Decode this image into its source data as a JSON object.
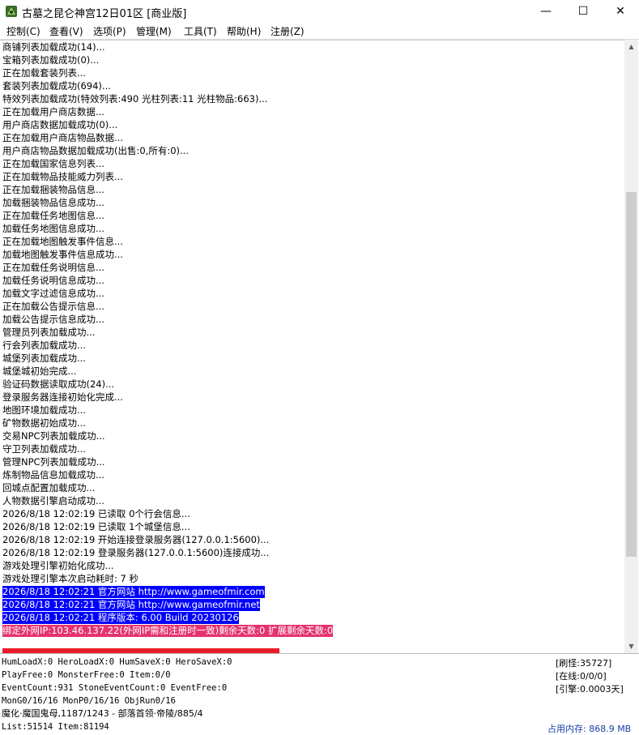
{
  "window": {
    "title": "古墓之昆仑神宫12日01区 [商业版]",
    "minimize_glyph": "—",
    "maximize_glyph": "☐",
    "close_glyph": "✕"
  },
  "menu": [
    "控制(C)",
    "查看(V)",
    "选项(P)",
    "管理(M)",
    "工具(T)",
    "帮助(H)",
    "注册(Z)"
  ],
  "log_lines": [
    "商铺列表加载成功(14)...",
    "宝箱列表加载成功(0)...",
    "正在加载套装列表...",
    "套装列表加载成功(694)...",
    "特效列表加载成功(特效列表:490 光柱列表:11 光柱物品:663)...",
    "正在加载用户商店数据...",
    "用户商店数据加载成功(0)...",
    "正在加载用户商店物品数据...",
    "用户商店物品数据加载成功(出售:0,所有:0)...",
    "正在加载国家信息列表...",
    "正在加载物品技能威力列表...",
    "正在加载捆装物品信息...",
    "加载捆装物品信息成功...",
    "正在加载任务地图信息...",
    "加载任务地图信息成功...",
    "正在加载地图触发事件信息...",
    "加载地图触发事件信息成功...",
    "正在加载任务说明信息...",
    "加载任务说明信息成功...",
    "加载文字过滤信息成功...",
    "正在加载公告提示信息...",
    "加载公告提示信息成功...",
    "管理员列表加载成功...",
    "行会列表加载成功...",
    "城堡列表加载成功...",
    "城堡城初始完成...",
    "验证码数据读取成功(24)...",
    "登录服务器连接初始化完成...",
    "地图环境加载成功...",
    "矿物数据初始成功...",
    "交易NPC列表加载成功...",
    "守卫列表加载成功...",
    "管理NPC列表加载成功...",
    "炼制物品信息加载成功...",
    "回城点配置加载成功...",
    "人物数据引擎启动成功...",
    "2026/8/18 12:02:19 已读取 0个行会信息...",
    "2026/8/18 12:02:19 已读取 1个城堡信息...",
    "2026/8/18 12:02:19 开始连接登录服务器(127.0.0.1:5600)...",
    "2026/8/18 12:02:19 登录服务器(127.0.0.1:5600)连接成功...",
    "游戏处理引擎初始化成功...",
    "游戏处理引擎本次启动耗时: 7 秒",
    "2026/8/18 12:02:21 官方网站 http://www.gameofmir.com",
    "2026/8/18 12:02:21 官方网站 http://www.gameofmir.net",
    "2026/8/18 12:02:21 程序版本: 6.00 Build 20230126",
    "绑定外网IP:103.46.137.22(外网IP需和注册时一致)剩余天数:0 扩展剩余天数:0"
  ],
  "status": {
    "line1": "HumLoadX:0 HeroLoadX:0 HumSaveX:0 HeroSaveX:0",
    "line2": "PlayFree:0 MonsterFree:0 Item:0/0",
    "line3": "EventCount:931 StoneEventCount:0 EventFree:0",
    "line4": "MonG0/16/16 MonP0/16/16 ObjRun0/16",
    "line5": "魔化·魔国鬼母,1187/1243 - 部落首领·帝陵/885/4",
    "line6": "List:51514 Item:81194",
    "refresh": "[刷怪:35727]",
    "online": "[在线:0/0/0]",
    "engine": "[引擎:0.0003天]",
    "memory": "占用内存: 868.9 MB"
  },
  "colors": {
    "highlight_blue": "#0000ff",
    "highlight_pink": "#e5336e",
    "highlight_red": "#ea1c2a",
    "memory_text": "#1a3fa8"
  },
  "icons": [
    "app-icon",
    "minimize-icon",
    "maximize-icon",
    "close-icon",
    "scroll-up-icon",
    "scroll-down-icon"
  ]
}
